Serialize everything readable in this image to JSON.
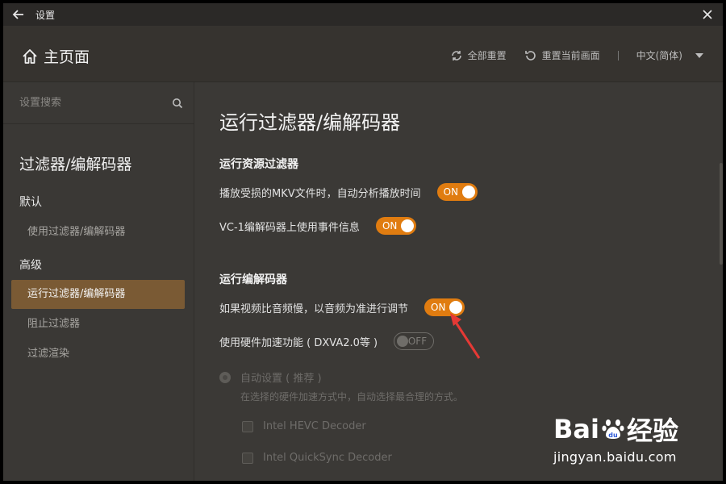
{
  "window": {
    "title": "设置"
  },
  "header": {
    "home_label": "主页面",
    "reset_all": "全部重置",
    "reset_current": "重置当前画面",
    "language": "中文(简体)"
  },
  "sidebar": {
    "search_placeholder": "设置搜索",
    "title": "过滤器/编解码器",
    "groups": [
      {
        "label": "默认",
        "items": [
          {
            "label": "使用过滤器/编解码器",
            "active": false
          }
        ]
      },
      {
        "label": "高级",
        "items": [
          {
            "label": "运行过滤器/编解码器",
            "active": true
          },
          {
            "label": "阻止过滤器",
            "active": false
          },
          {
            "label": "过滤渲染",
            "active": false
          }
        ]
      }
    ]
  },
  "main": {
    "title": "运行过滤器/编解码器",
    "sections": [
      {
        "title": "运行资源过滤器",
        "rows": [
          {
            "label": "播放受损的MKV文件时，自动分析播放时间",
            "toggle": "ON"
          },
          {
            "label": "VC-1编解码器上使用事件信息",
            "toggle": "ON"
          }
        ]
      },
      {
        "title": "运行编解码器",
        "rows": [
          {
            "label": "如果视频比音频慢，以音频为准进行调节",
            "toggle": "ON"
          },
          {
            "label": "使用硬件加速功能 ( DXVA2.0等 )",
            "toggle": "OFF"
          }
        ]
      }
    ],
    "hw_options": {
      "auto_label": "自动设置 ( 推荐 )",
      "auto_desc": "在选择的硬件加速方式中，自动选择最合理的方式。",
      "decoders": [
        "Intel HEVC Decoder",
        "Intel QuickSync Decoder"
      ]
    }
  },
  "watermark": {
    "brand_left": "Bai",
    "brand_right": "经验",
    "paw_letters": "du",
    "url": "jingyan.baidu.com"
  },
  "colors": {
    "accent": "#e07c10",
    "active_bg": "#7a5a34",
    "annotation_arrow": "#e53935"
  }
}
